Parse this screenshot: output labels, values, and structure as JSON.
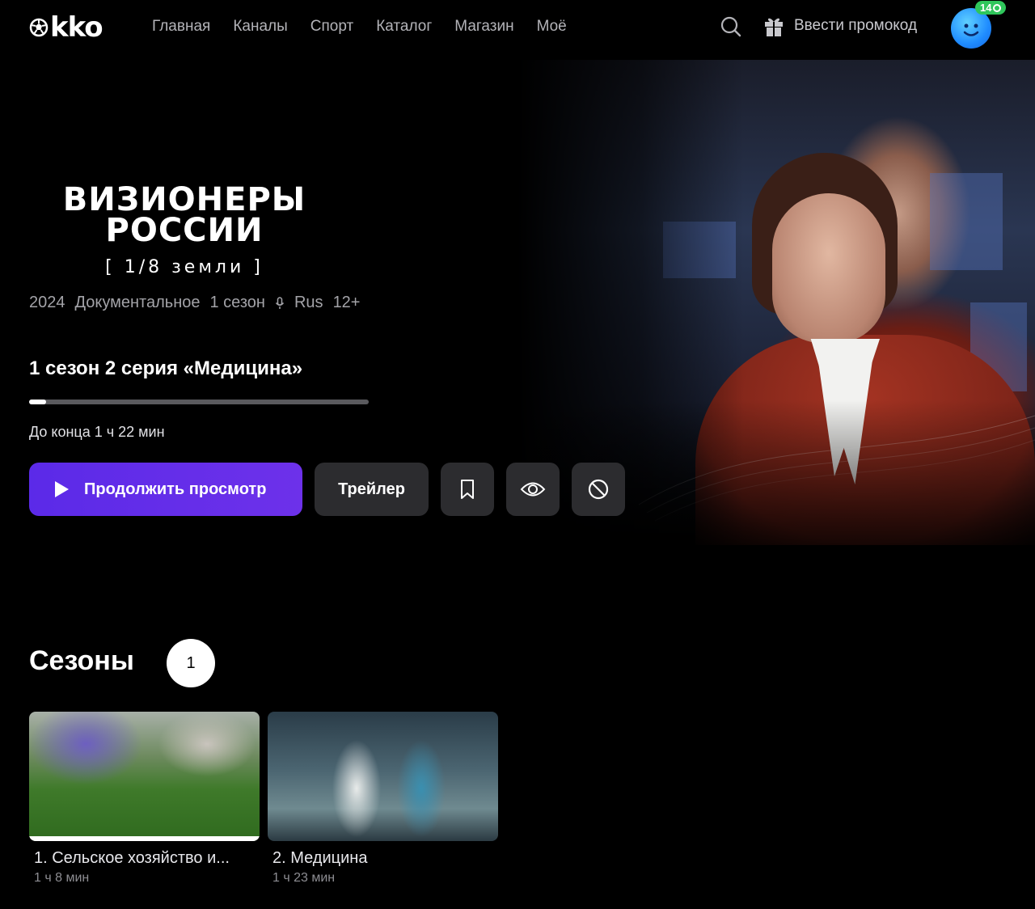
{
  "header": {
    "logo": "kko",
    "nav": [
      "Главная",
      "Каналы",
      "Спорт",
      "Каталог",
      "Магазин",
      "Моё"
    ],
    "promo_label": "Ввести промокод",
    "bonus_badge": "14"
  },
  "hero": {
    "title_line1": "Визионеры",
    "title_line2": "России",
    "title_sub": "[ 1/8 земли ]",
    "meta": {
      "year": "2024",
      "genre": "Документальное",
      "seasons": "1 сезон",
      "audio": "Rus",
      "age": "12+"
    },
    "current_episode": "1 сезон 2 серия «Медицина»",
    "progress": 0.05,
    "remaining": "До конца 1 ч 22 мин",
    "continue_label": "Продолжить просмотр",
    "trailer_label": "Трейлер"
  },
  "seasons": {
    "title": "Сезоны",
    "selected": "1"
  },
  "episodes": [
    {
      "title": "1. Сельское хозяйство и...",
      "duration": "1 ч 8 мин",
      "progress": 1.0
    },
    {
      "title": "2. Медицина",
      "duration": "1 ч 23 мин",
      "progress": 0
    }
  ],
  "colors": {
    "accent": "#5b2ae8",
    "button_bg": "#2c2c2f",
    "badge_green": "#2fc65b"
  },
  "icons": [
    "search-icon",
    "gift-icon",
    "play-icon",
    "bookmark-icon",
    "eye-icon",
    "block-icon",
    "mic-icon"
  ]
}
